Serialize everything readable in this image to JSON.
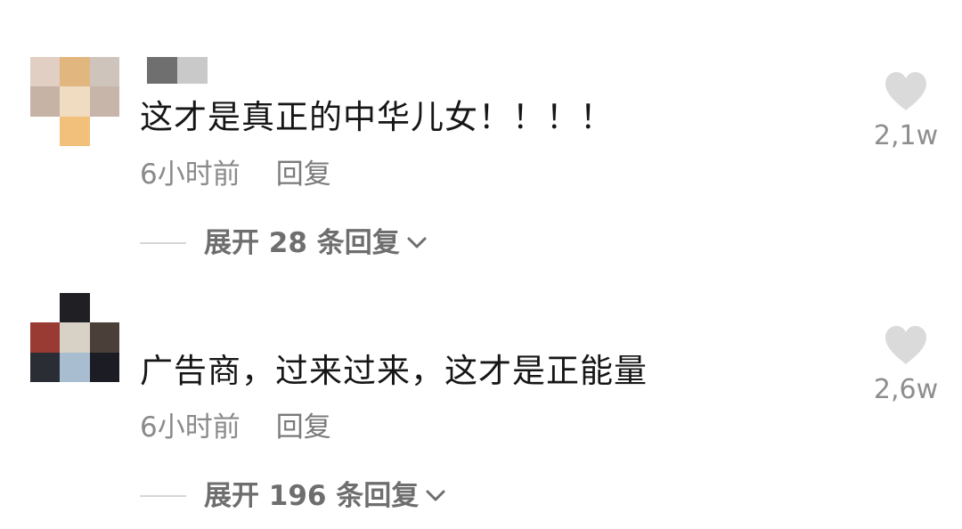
{
  "comments": [
    {
      "text": "这才是真正的中华儿女！！！！",
      "time": "6小时前",
      "reply_label": "回复",
      "expand_label": "展开 28 条回复",
      "likes": "2,1w",
      "avatar_colors": [
        "#e0cfc2",
        "#e2b67f",
        "#cfc4bc",
        "#c7b3a5",
        "#f0dcc0",
        "#c6b5a8",
        "#ffffff",
        "#f2c07a",
        "#ffffff"
      ],
      "username_colors": [
        "#6f6f6f",
        "#c9c9c9"
      ]
    },
    {
      "text": "广告商，过来过来，这才是正能量",
      "time": "6小时前",
      "reply_label": "回复",
      "expand_label": "展开 196 条回复",
      "likes": "2,6w",
      "avatar_colors": [
        "#ffffff",
        "#1f1f24",
        "#ffffff",
        "#9a3b33",
        "#d8d1c6",
        "#4a4039",
        "#2b2d35",
        "#a9bdd0",
        "#1c1d24"
      ]
    }
  ],
  "colors": {
    "text": "#161616",
    "meta": "#8a8a8a",
    "heart": "#dadada"
  },
  "icons": {
    "like": "heart-icon",
    "expand": "chevron-down-icon"
  }
}
